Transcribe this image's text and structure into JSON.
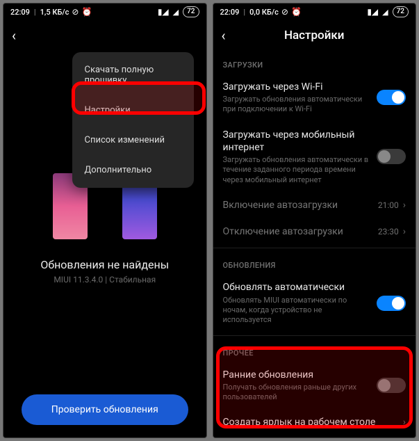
{
  "left": {
    "status": {
      "time": "22:09",
      "net": "1,5 КБ/с",
      "battery": "72"
    },
    "menu": {
      "items": [
        "Скачать полную прошивку",
        "Настройки",
        "Список изменений",
        "Дополнительно"
      ]
    },
    "status_text": "Обновления не найдены",
    "version": "MIUI 11.3.4.0 | Стабильная",
    "button": "Проверить обновления"
  },
  "right": {
    "status": {
      "time": "22:09",
      "net": "0,0 КБ/с",
      "battery": "72"
    },
    "title": "Настройки",
    "sections": {
      "downloads": {
        "label": "ЗАГРУЗКИ",
        "wifi": {
          "title": "Загружать через Wi-Fi",
          "desc": "Загружать обновления автоматически при подключении к Wi-Fi"
        },
        "mobile": {
          "title": "Загружать через мобильный интернет",
          "desc": "Загружать обновления автоматически в течение заданного периода времени через мобильный интернет"
        },
        "on_label": "Включение автозагрузки",
        "on_value": "21:00",
        "off_label": "Отключение автозагрузки",
        "off_value": "23:30"
      },
      "updates": {
        "label": "ОБНОВЛЕНИЯ",
        "auto": {
          "title": "Обновлять автоматически",
          "desc": "Обновлять MIUI автоматически по ночам, когда устройство не используется"
        }
      },
      "other": {
        "label": "ПРОЧЕЕ",
        "early": {
          "title": "Ранние обновления",
          "desc": "Получать обновления раньше других пользователей"
        },
        "shortcut": {
          "title": "Создать ярлык на рабочем столе"
        }
      }
    }
  }
}
